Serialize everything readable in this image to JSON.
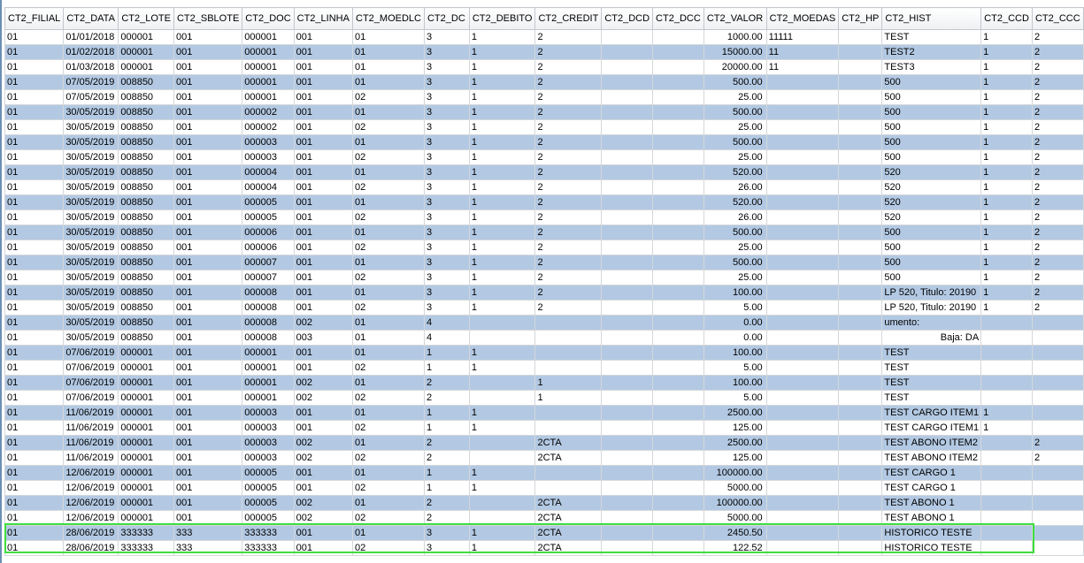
{
  "columns": [
    "CT2_FILIAL",
    "CT2_DATA",
    "CT2_LOTE",
    "CT2_SBLOTE",
    "CT2_DOC",
    "CT2_LINHA",
    "CT2_MOEDLC",
    "CT2_DC",
    "CT2_DEBITO",
    "CT2_CREDIT",
    "CT2_DCD",
    "CT2_DCC",
    "CT2_VALOR",
    "CT2_MOEDAS",
    "CT2_HP",
    "CT2_HIST",
    "CT2_CCD",
    "CT2_CCC"
  ],
  "rows": [
    [
      "01",
      "01/01/2018",
      "000001",
      "001",
      "000001",
      "001",
      "01",
      "3",
      "1",
      "2",
      "",
      "",
      "1000.00",
      "11111",
      "",
      "TEST",
      "1",
      "2"
    ],
    [
      "01",
      "01/02/2018",
      "000001",
      "001",
      "000001",
      "001",
      "01",
      "3",
      "1",
      "2",
      "",
      "",
      "15000.00",
      "11",
      "",
      "TEST2",
      "1",
      "2"
    ],
    [
      "01",
      "01/03/2018",
      "000001",
      "001",
      "000001",
      "001",
      "01",
      "3",
      "1",
      "2",
      "",
      "",
      "20000.00",
      "11",
      "",
      "TEST3",
      "1",
      "2"
    ],
    [
      "01",
      "07/05/2019",
      "008850",
      "001",
      "000001",
      "001",
      "01",
      "3",
      "1",
      "2",
      "",
      "",
      "500.00",
      "",
      "",
      "500",
      "1",
      "2"
    ],
    [
      "01",
      "07/05/2019",
      "008850",
      "001",
      "000001",
      "001",
      "02",
      "3",
      "1",
      "2",
      "",
      "",
      "25.00",
      "",
      "",
      "500",
      "1",
      "2"
    ],
    [
      "01",
      "30/05/2019",
      "008850",
      "001",
      "000002",
      "001",
      "01",
      "3",
      "1",
      "2",
      "",
      "",
      "500.00",
      "",
      "",
      "500",
      "1",
      "2"
    ],
    [
      "01",
      "30/05/2019",
      "008850",
      "001",
      "000002",
      "001",
      "02",
      "3",
      "1",
      "2",
      "",
      "",
      "25.00",
      "",
      "",
      "500",
      "1",
      "2"
    ],
    [
      "01",
      "30/05/2019",
      "008850",
      "001",
      "000003",
      "001",
      "01",
      "3",
      "1",
      "2",
      "",
      "",
      "500.00",
      "",
      "",
      "500",
      "1",
      "2"
    ],
    [
      "01",
      "30/05/2019",
      "008850",
      "001",
      "000003",
      "001",
      "02",
      "3",
      "1",
      "2",
      "",
      "",
      "25.00",
      "",
      "",
      "500",
      "1",
      "2"
    ],
    [
      "01",
      "30/05/2019",
      "008850",
      "001",
      "000004",
      "001",
      "01",
      "3",
      "1",
      "2",
      "",
      "",
      "520.00",
      "",
      "",
      "520",
      "1",
      "2"
    ],
    [
      "01",
      "30/05/2019",
      "008850",
      "001",
      "000004",
      "001",
      "02",
      "3",
      "1",
      "2",
      "",
      "",
      "26.00",
      "",
      "",
      "520",
      "1",
      "2"
    ],
    [
      "01",
      "30/05/2019",
      "008850",
      "001",
      "000005",
      "001",
      "01",
      "3",
      "1",
      "2",
      "",
      "",
      "520.00",
      "",
      "",
      "520",
      "1",
      "2"
    ],
    [
      "01",
      "30/05/2019",
      "008850",
      "001",
      "000005",
      "001",
      "02",
      "3",
      "1",
      "2",
      "",
      "",
      "26.00",
      "",
      "",
      "520",
      "1",
      "2"
    ],
    [
      "01",
      "30/05/2019",
      "008850",
      "001",
      "000006",
      "001",
      "01",
      "3",
      "1",
      "2",
      "",
      "",
      "500.00",
      "",
      "",
      "500",
      "1",
      "2"
    ],
    [
      "01",
      "30/05/2019",
      "008850",
      "001",
      "000006",
      "001",
      "02",
      "3",
      "1",
      "2",
      "",
      "",
      "25.00",
      "",
      "",
      "500",
      "1",
      "2"
    ],
    [
      "01",
      "30/05/2019",
      "008850",
      "001",
      "000007",
      "001",
      "01",
      "3",
      "1",
      "2",
      "",
      "",
      "500.00",
      "",
      "",
      "500",
      "1",
      "2"
    ],
    [
      "01",
      "30/05/2019",
      "008850",
      "001",
      "000007",
      "001",
      "02",
      "3",
      "1",
      "2",
      "",
      "",
      "25.00",
      "",
      "",
      "500",
      "1",
      "2"
    ],
    [
      "01",
      "30/05/2019",
      "008850",
      "001",
      "000008",
      "001",
      "01",
      "3",
      "1",
      "2",
      "",
      "",
      "100.00",
      "",
      "",
      "LP 520, Titulo: 20190",
      "1",
      "2"
    ],
    [
      "01",
      "30/05/2019",
      "008850",
      "001",
      "000008",
      "001",
      "02",
      "3",
      "1",
      "2",
      "",
      "",
      "5.00",
      "",
      "",
      "LP 520, Titulo: 20190",
      "1",
      "2"
    ],
    [
      "01",
      "30/05/2019",
      "008850",
      "001",
      "000008",
      "002",
      "01",
      "4",
      "",
      "",
      "",
      "",
      "0.00",
      "",
      "",
      "umento:",
      "",
      ""
    ],
    [
      "01",
      "30/05/2019",
      "008850",
      "001",
      "000008",
      "003",
      "01",
      "4",
      "",
      "",
      "",
      "",
      "0.00",
      "",
      "",
      "Baja: DA",
      "",
      ""
    ],
    [
      "01",
      "07/06/2019",
      "000001",
      "001",
      "000001",
      "001",
      "01",
      "1",
      "1",
      "",
      "",
      "",
      "100.00",
      "",
      "",
      "TEST",
      "",
      ""
    ],
    [
      "01",
      "07/06/2019",
      "000001",
      "001",
      "000001",
      "001",
      "02",
      "1",
      "1",
      "",
      "",
      "",
      "5.00",
      "",
      "",
      "TEST",
      "",
      ""
    ],
    [
      "01",
      "07/06/2019",
      "000001",
      "001",
      "000001",
      "002",
      "01",
      "2",
      "",
      "1",
      "",
      "",
      "100.00",
      "",
      "",
      "TEST",
      "",
      ""
    ],
    [
      "01",
      "07/06/2019",
      "000001",
      "001",
      "000001",
      "002",
      "02",
      "2",
      "",
      "1",
      "",
      "",
      "5.00",
      "",
      "",
      "TEST",
      "",
      ""
    ],
    [
      "01",
      "11/06/2019",
      "000001",
      "001",
      "000003",
      "001",
      "01",
      "1",
      "1",
      "",
      "",
      "",
      "2500.00",
      "",
      "",
      "TEST CARGO ITEM1",
      "1",
      ""
    ],
    [
      "01",
      "11/06/2019",
      "000001",
      "001",
      "000003",
      "001",
      "02",
      "1",
      "1",
      "",
      "",
      "",
      "125.00",
      "",
      "",
      "TEST CARGO ITEM1",
      "1",
      ""
    ],
    [
      "01",
      "11/06/2019",
      "000001",
      "001",
      "000003",
      "002",
      "01",
      "2",
      "",
      "2CTA",
      "",
      "",
      "2500.00",
      "",
      "",
      "TEST ABONO ITEM2",
      "",
      "2"
    ],
    [
      "01",
      "11/06/2019",
      "000001",
      "001",
      "000003",
      "002",
      "02",
      "2",
      "",
      "2CTA",
      "",
      "",
      "125.00",
      "",
      "",
      "TEST ABONO ITEM2",
      "",
      "2"
    ],
    [
      "01",
      "12/06/2019",
      "000001",
      "001",
      "000005",
      "001",
      "01",
      "1",
      "1",
      "",
      "",
      "",
      "100000.00",
      "",
      "",
      "TEST CARGO 1",
      "",
      ""
    ],
    [
      "01",
      "12/06/2019",
      "000001",
      "001",
      "000005",
      "001",
      "02",
      "1",
      "1",
      "",
      "",
      "",
      "5000.00",
      "",
      "",
      "TEST CARGO 1",
      "",
      ""
    ],
    [
      "01",
      "12/06/2019",
      "000001",
      "001",
      "000005",
      "002",
      "01",
      "2",
      "",
      "2CTA",
      "",
      "",
      "100000.00",
      "",
      "",
      "TEST ABONO 1",
      "",
      ""
    ],
    [
      "01",
      "12/06/2019",
      "000001",
      "001",
      "000005",
      "002",
      "02",
      "2",
      "",
      "2CTA",
      "",
      "",
      "5000.00",
      "",
      "",
      "TEST ABONO 1",
      "",
      ""
    ],
    [
      "01",
      "28/06/2019",
      "333333",
      "333",
      "333333",
      "001",
      "01",
      "3",
      "1",
      "2CTA",
      "",
      "",
      "2450.50",
      "",
      "",
      "HISTORICO TESTE",
      "",
      ""
    ],
    [
      "01",
      "28/06/2019",
      "333333",
      "333",
      "333333",
      "001",
      "02",
      "3",
      "1",
      "2CTA",
      "",
      "",
      "122.52",
      "",
      "",
      "HISTORICO TESTE",
      "",
      ""
    ]
  ],
  "selected_rows": [
    33,
    34
  ],
  "colors": {
    "row_alt": "#b3c9e3",
    "selection_border": "#3fdd3f",
    "grid_left_border": "#6b8fb5"
  }
}
